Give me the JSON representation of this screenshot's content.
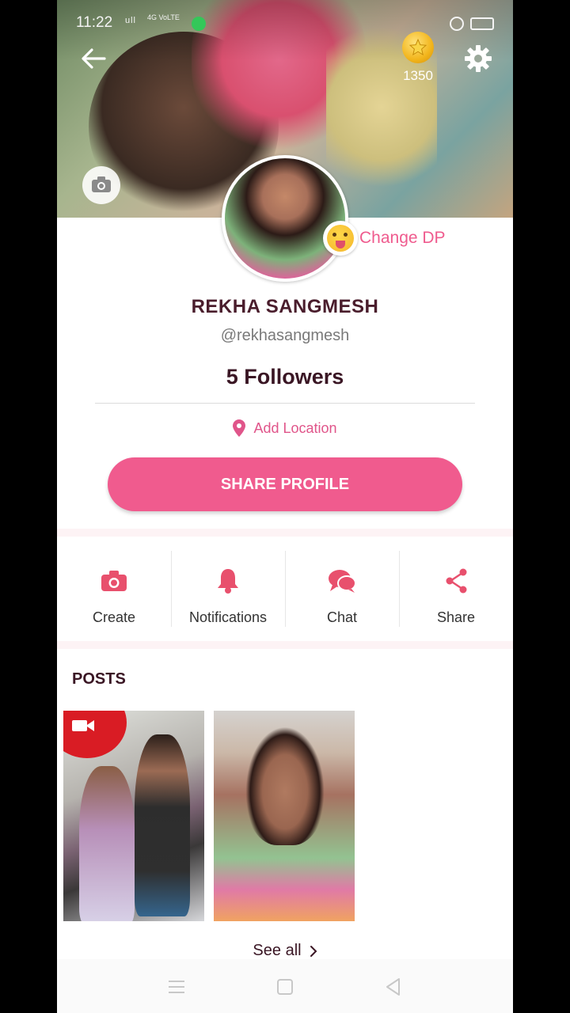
{
  "status_bar": {
    "time": "11:22",
    "signal": "ull",
    "network": "4G VoLTE"
  },
  "header": {
    "coin_count": "1350"
  },
  "profile": {
    "change_dp_label": "Change DP",
    "name": "REKHA SANGMESH",
    "handle": "@rekhasangmesh",
    "followers": "5 Followers",
    "location_label": "Add Location",
    "share_button": "SHARE PROFILE"
  },
  "actions": [
    {
      "label": "Create",
      "icon": "camera-icon"
    },
    {
      "label": "Notifications",
      "icon": "bell-icon"
    },
    {
      "label": "Chat",
      "icon": "chat-bubbles-icon"
    },
    {
      "label": "Share",
      "icon": "share-icon"
    }
  ],
  "posts": {
    "title": "POSTS",
    "see_all": "See all"
  },
  "colors": {
    "accent": "#f05b8e",
    "accent_text": "#e0558a",
    "name_text": "#4a1d2c"
  }
}
